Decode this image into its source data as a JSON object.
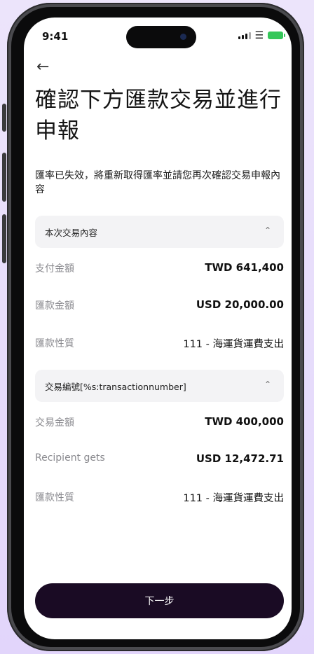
{
  "status_bar": {
    "time": "9:41",
    "wifi_icon": "wifi-icon",
    "battery_icon": "battery-icon"
  },
  "header": {
    "back_icon": "arrow-left-icon",
    "title": "確認下方匯款交易並進行申報"
  },
  "notice": "匯率已失效，將重新取得匯率並請您再次確認交易申報內容",
  "sections": [
    {
      "label": "本次交易內容",
      "rows": [
        {
          "label": "支付金額",
          "value": "TWD 641,400"
        },
        {
          "label": "匯款金額",
          "value": "USD 20,000.00"
        },
        {
          "label": "匯款性質",
          "value": "111 - 海運貨運費支出"
        }
      ]
    },
    {
      "label": "交易編號[%s:transactionnumber]",
      "rows": [
        {
          "label": "交易金額",
          "value": "TWD 400,000"
        },
        {
          "label": "Recipient gets",
          "value": "USD 12,472.71"
        },
        {
          "label": "匯款性質",
          "value": "111 - 海運貨運費支出"
        }
      ]
    }
  ],
  "footer": {
    "next_label": "下一步"
  },
  "colors": {
    "button_bg": "#1a0b24",
    "battery": "#35c759",
    "background": "#e6dafb"
  }
}
